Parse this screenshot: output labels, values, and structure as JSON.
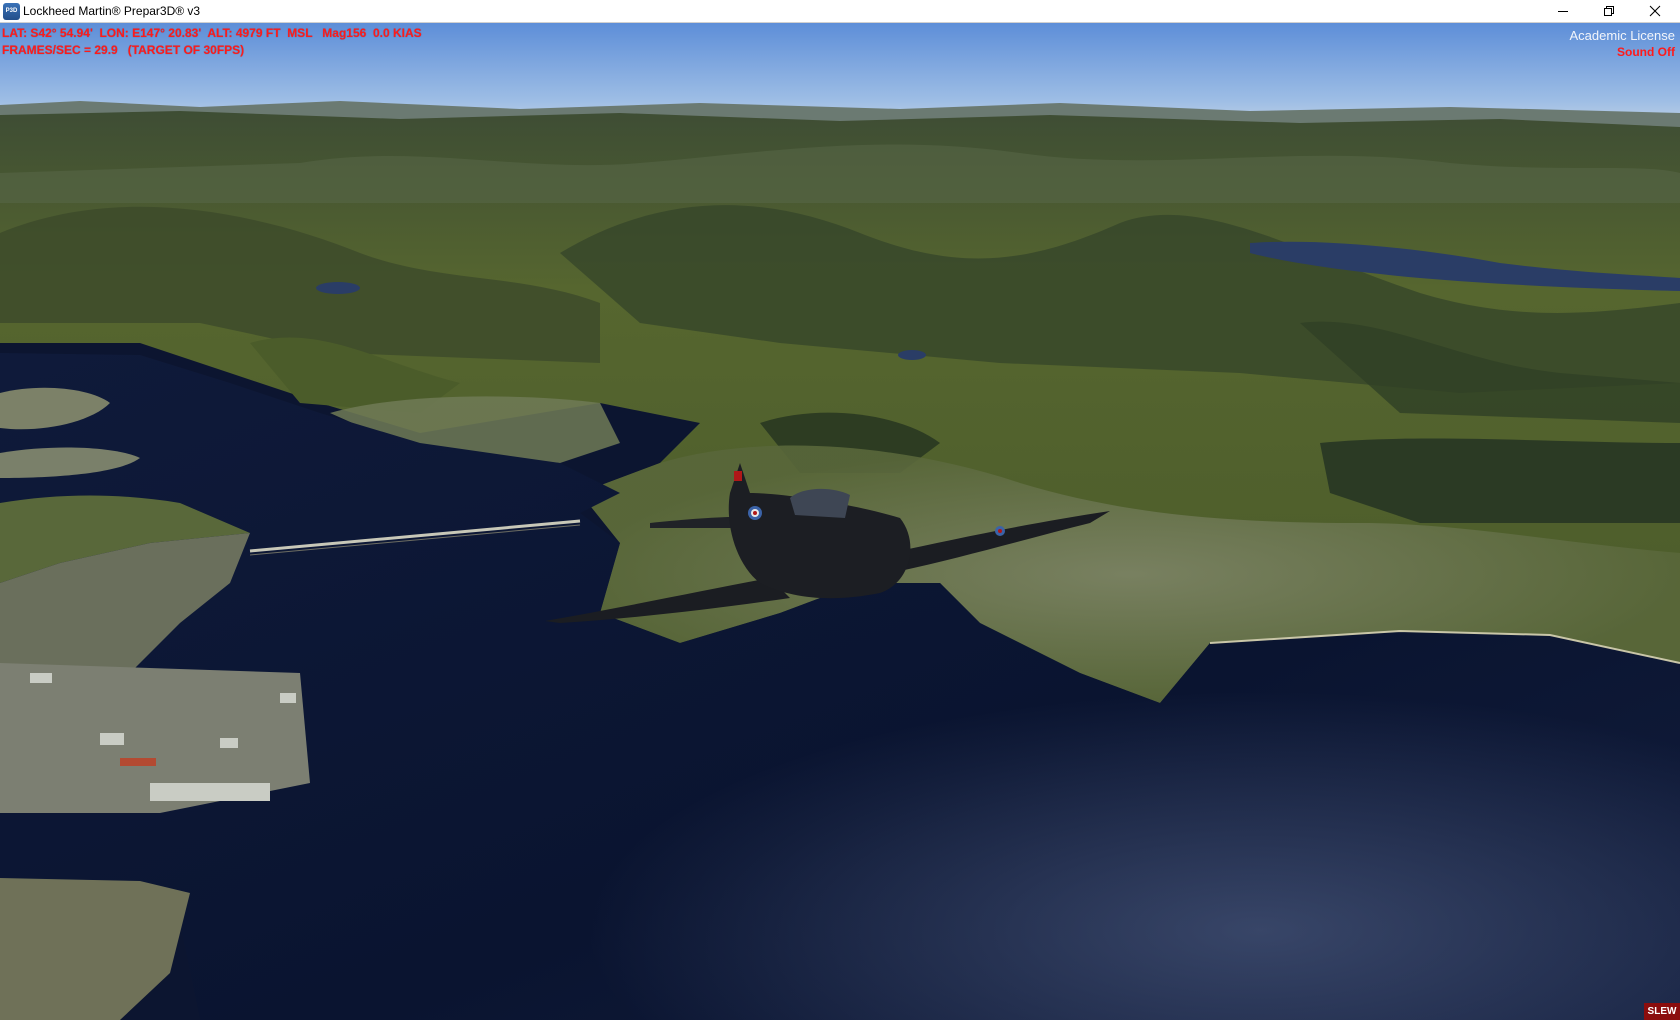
{
  "window": {
    "title": "Lockheed Martin® Prepar3D® v3",
    "app_icon_text": "P3D",
    "controls": [
      "minimize-icon",
      "restore-icon",
      "close-icon"
    ]
  },
  "hud": {
    "position_line": "LAT: S42° 54.94'  LON: E147° 20.83'  ALT: 4979 FT  MSL   Mag156  0.0 KIAS",
    "fps_line": "FRAMES/SEC = 29.9   (TARGET OF 30FPS)",
    "license": "Academic License",
    "sound": "Sound Off",
    "slew": "SLEW"
  },
  "colors": {
    "hud_text": "#ff1a1a",
    "sky_top": "#5d8ed8",
    "water": "#0b1530",
    "terrain": "#4d5f2c",
    "slew_bg": "#8b0d0d"
  }
}
